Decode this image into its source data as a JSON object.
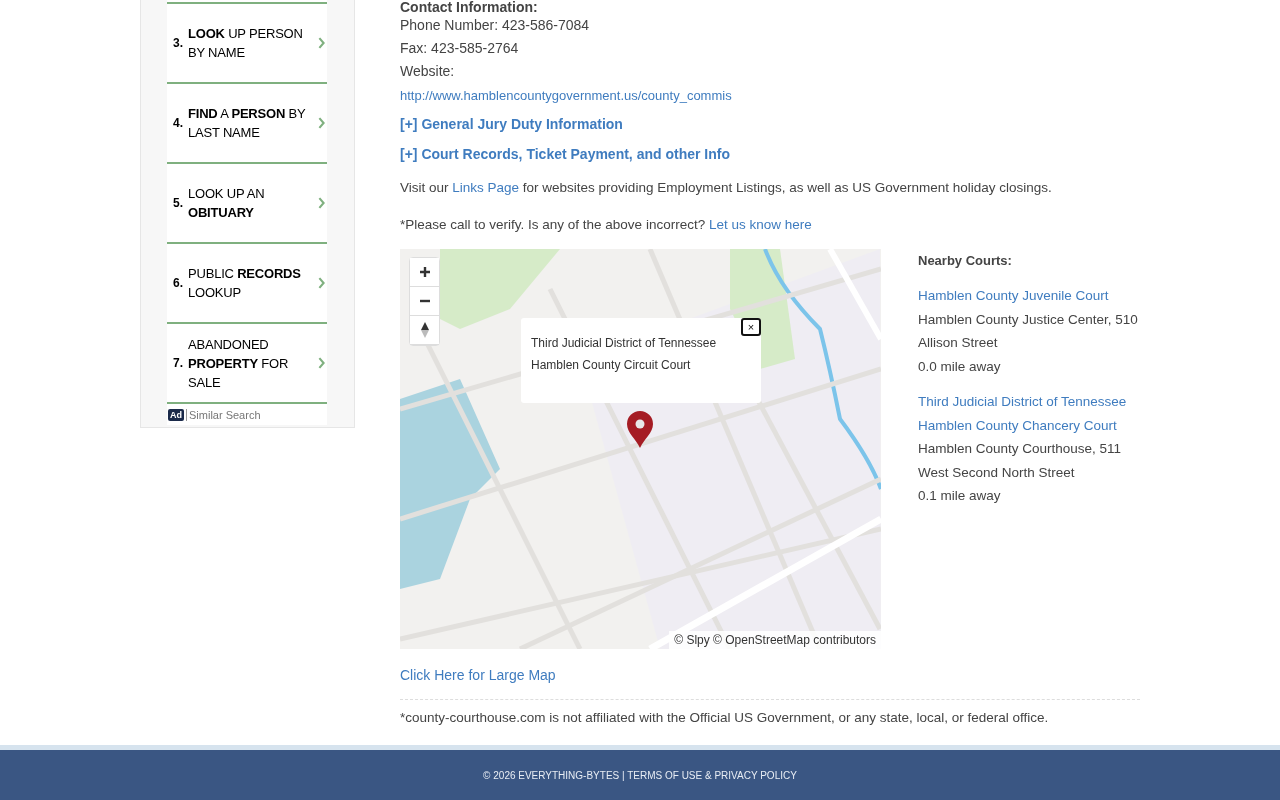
{
  "sidebar": {
    "ads": [
      {
        "number": "3.",
        "text": "**LOOK** UP PERSON BY NAME"
      },
      {
        "number": "4.",
        "text": "**FIND** A **PERSON** BY LAST NAME"
      },
      {
        "number": "5.",
        "text": "LOOK UP AN **OBITUARY**"
      },
      {
        "number": "6.",
        "text": "PUBLIC **RECORDS** LOOKUP"
      },
      {
        "number": "7.",
        "text": "ABANDONED **PROPERTY** FOR SALE"
      }
    ],
    "ad_badge": "Ad",
    "ad_footer": "Similar Search"
  },
  "contact": {
    "heading": "Contact Information:",
    "phone": "Phone Number: 423-586-7084",
    "fax": "Fax: 423-585-2764",
    "website_label": "Website:",
    "website_url": "http://www.hamblencountygovernment.us/county_commis"
  },
  "expanders": [
    {
      "label": "[+] General Jury Duty Information"
    },
    {
      "label": "[+] Court Records, Ticket Payment, and other Info"
    }
  ],
  "links_note": {
    "before": "Visit our",
    "link": "Links Page",
    "after": "for websites providing Employment Listings, as well as US Government holiday closings."
  },
  "verify_note": {
    "text": "*Please call to verify. Is any of the above incorrect?",
    "link": "Let us know here"
  },
  "map": {
    "popup": [
      "Third Judicial District of Tennessee",
      "Hamblen County Circuit Court"
    ],
    "close": "×",
    "attribution": "© Slpy © OpenStreetMap contributors"
  },
  "nearby": {
    "heading": "Nearby Courts:",
    "courts": [
      {
        "names": [
          "Hamblen County Juvenile Court"
        ],
        "address": "Hamblen County Justice Center, 510 Allison Street",
        "distance": "0.0 mile away"
      },
      {
        "names": [
          "Third Judicial District of Tennessee",
          "Hamblen County Chancery Court"
        ],
        "address": "Hamblen County Courthouse, 511 West Second North Street",
        "distance": "0.1 mile away"
      }
    ]
  },
  "large_map_link": "Click Here for Large Map",
  "disclaimer": "*county-courthouse.com is not affiliated with the Official US Government, or any state, local, or federal office.",
  "footer": "© 2026 EVERYTHING-BYTES | TERMS OF USE & PRIVACY POLICY"
}
